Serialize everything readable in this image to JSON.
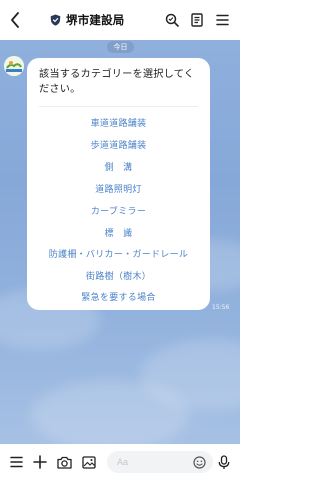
{
  "header": {
    "title": "堺市建設局",
    "back_icon": "chevron-left-icon",
    "search_icon": "search-icon",
    "notes_icon": "notes-icon",
    "menu_icon": "menu-icon"
  },
  "chat": {
    "date_label": "今日",
    "message": {
      "text": "該当するカテゴリーを選択してください。",
      "time": "15:56",
      "options": [
        "車道道路舗装",
        "歩道道路舗装",
        "側　溝",
        "道路照明灯",
        "カーブミラー",
        "標　識",
        "防護柵・バリカー・ガードレール",
        "街路樹（樹木）",
        "緊急を要する場合"
      ]
    }
  },
  "footer": {
    "input_placeholder": "Aa",
    "icons": [
      "menu-icon",
      "plus-icon",
      "camera-icon",
      "image-icon",
      "emoji-icon",
      "mic-icon"
    ]
  },
  "colors": {
    "accent_link": "#4c83c9",
    "chat_background": "#8fb0dd"
  }
}
